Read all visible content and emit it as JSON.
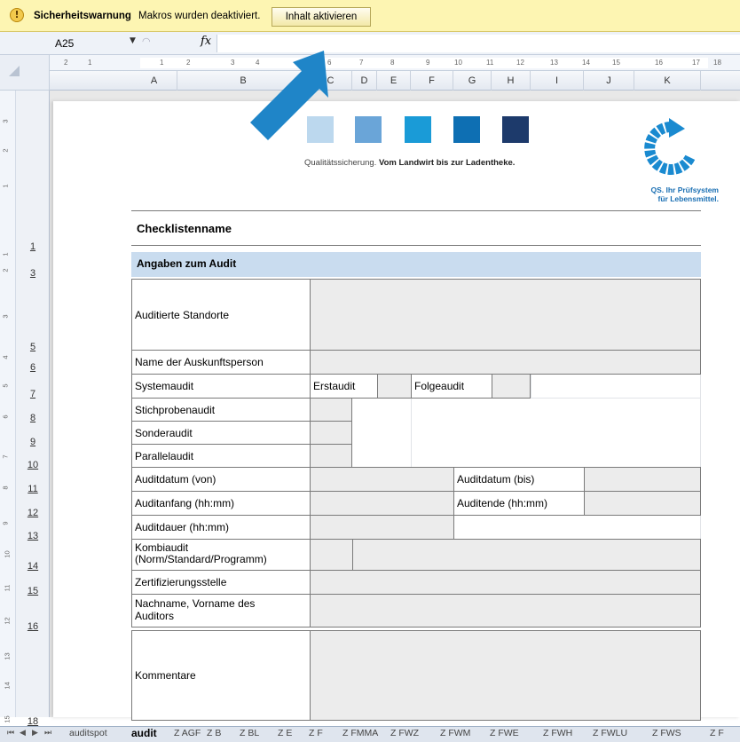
{
  "security_bar": {
    "title": "Sicherheitswarnung",
    "message": "Makros wurden deaktiviert.",
    "button": "Inhalt aktivieren",
    "icon": "!"
  },
  "formula_bar": {
    "name_box": "A25",
    "fx": "fx",
    "value": ""
  },
  "columns": [
    "A",
    "B",
    "C",
    "D",
    "E",
    "F",
    "G",
    "H",
    "I",
    "J",
    "K"
  ],
  "ruler_numbers": [
    "2",
    "1",
    "1",
    "2",
    "3",
    "4",
    "6",
    "7",
    "8",
    "9",
    "10",
    "11",
    "12",
    "13",
    "14",
    "15",
    "16",
    "17",
    "18"
  ],
  "vruler_numbers": [
    "3",
    "2",
    "1",
    "1",
    "2",
    "3",
    "4",
    "5",
    "6",
    "7",
    "8",
    "9",
    "10",
    "11",
    "12",
    "13",
    "14",
    "15"
  ],
  "rows": [
    "1",
    "3",
    "5",
    "6",
    "7",
    "8",
    "9",
    "10",
    "11",
    "12",
    "13",
    "14",
    "15",
    "16",
    "18"
  ],
  "header": {
    "tagline_regular": "Qualitätssicherung.",
    "tagline_bold": "Vom Landwirt bis zur Ladentheke.",
    "qs_line1": "QS. Ihr Prüfsystem",
    "qs_line2": "für Lebensmittel.",
    "colors": [
      "#bcd8ee",
      "#6aa5d8",
      "#1a9bd7",
      "#0e6fb3",
      "#1d3a6b"
    ]
  },
  "form": {
    "checklist_title": "Checklistenname",
    "section_title": "Angaben zum Audit",
    "rows": {
      "auditierte_standorte": "Auditierte Standorte",
      "auskunftsperson": "Name der Auskunftsperson",
      "systemaudit": "Systemaudit",
      "erstaudit": "Erstaudit",
      "folgeaudit": "Folgeaudit",
      "stichprobenaudit": "Stichprobenaudit",
      "sonderaudit": "Sonderaudit",
      "parallelaudit": "Parallelaudit",
      "auditdatum_von": "Auditdatum (von)",
      "auditdatum_bis": "Auditdatum (bis)",
      "auditanfang": "Auditanfang (hh:mm)",
      "auditende": "Auditende (hh:mm)",
      "auditdauer": "Auditdauer (hh:mm)",
      "kombiaudit_1": "Kombiaudit",
      "kombiaudit_2": "(Norm/Standard/Programm)",
      "zertifizierungsstelle": "Zertifizierungsstelle",
      "auditor_1": "Nachname, Vorname des",
      "auditor_2": "Auditors",
      "kommentare": "Kommentare"
    }
  },
  "sheet_tabs": [
    "auditspot",
    "audit",
    "Z AGF",
    "Z B",
    "Z BL",
    "Z E",
    "Z F",
    "Z FMMA",
    "Z FWZ",
    "Z FWM",
    "Z FWE",
    "Z FWH",
    "Z FWLU",
    "Z FWS",
    "Z F"
  ],
  "nav_buttons": [
    "⏮",
    "◀",
    "▶",
    "⏭"
  ]
}
